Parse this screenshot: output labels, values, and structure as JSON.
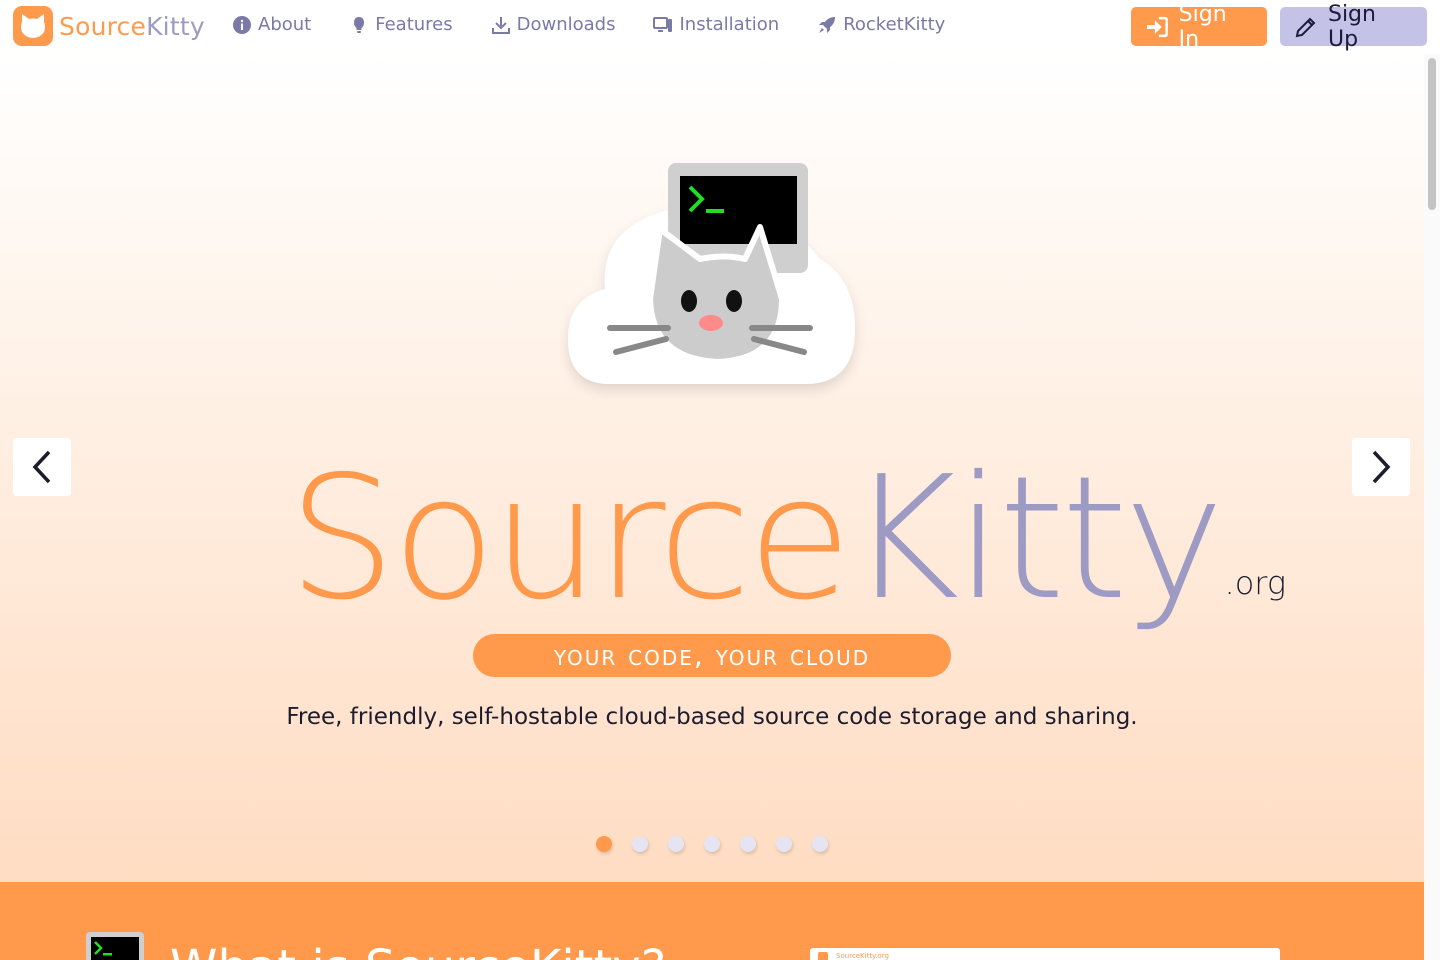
{
  "nav": {
    "brand_source": "Source",
    "brand_kitty": "Kitty",
    "links": [
      {
        "label": "About",
        "icon": "info-circle-icon"
      },
      {
        "label": "Features",
        "icon": "lightbulb-icon"
      },
      {
        "label": "Downloads",
        "icon": "download-icon"
      },
      {
        "label": "Installation",
        "icon": "desktop-icon"
      },
      {
        "label": "RocketKitty",
        "icon": "rocket-icon"
      }
    ],
    "signin_label": "Sign In",
    "signup_label": "Sign Up"
  },
  "hero": {
    "wordmark_source": "Source",
    "wordmark_kitty": "Kitty",
    "wordmark_tld": ".org",
    "tagline": "your code, your cloud",
    "description": "Free, friendly, self-hostable cloud-based source code storage and sharing.",
    "slides_count": 7,
    "active_slide": 1
  },
  "about": {
    "heading": "What is SourceKitty?",
    "screenshot_brand": "SourceKitty.org"
  },
  "colors": {
    "orange": "#ff9a4d",
    "lavender": "#9d9bc4",
    "terminal_green": "#22dd22"
  }
}
